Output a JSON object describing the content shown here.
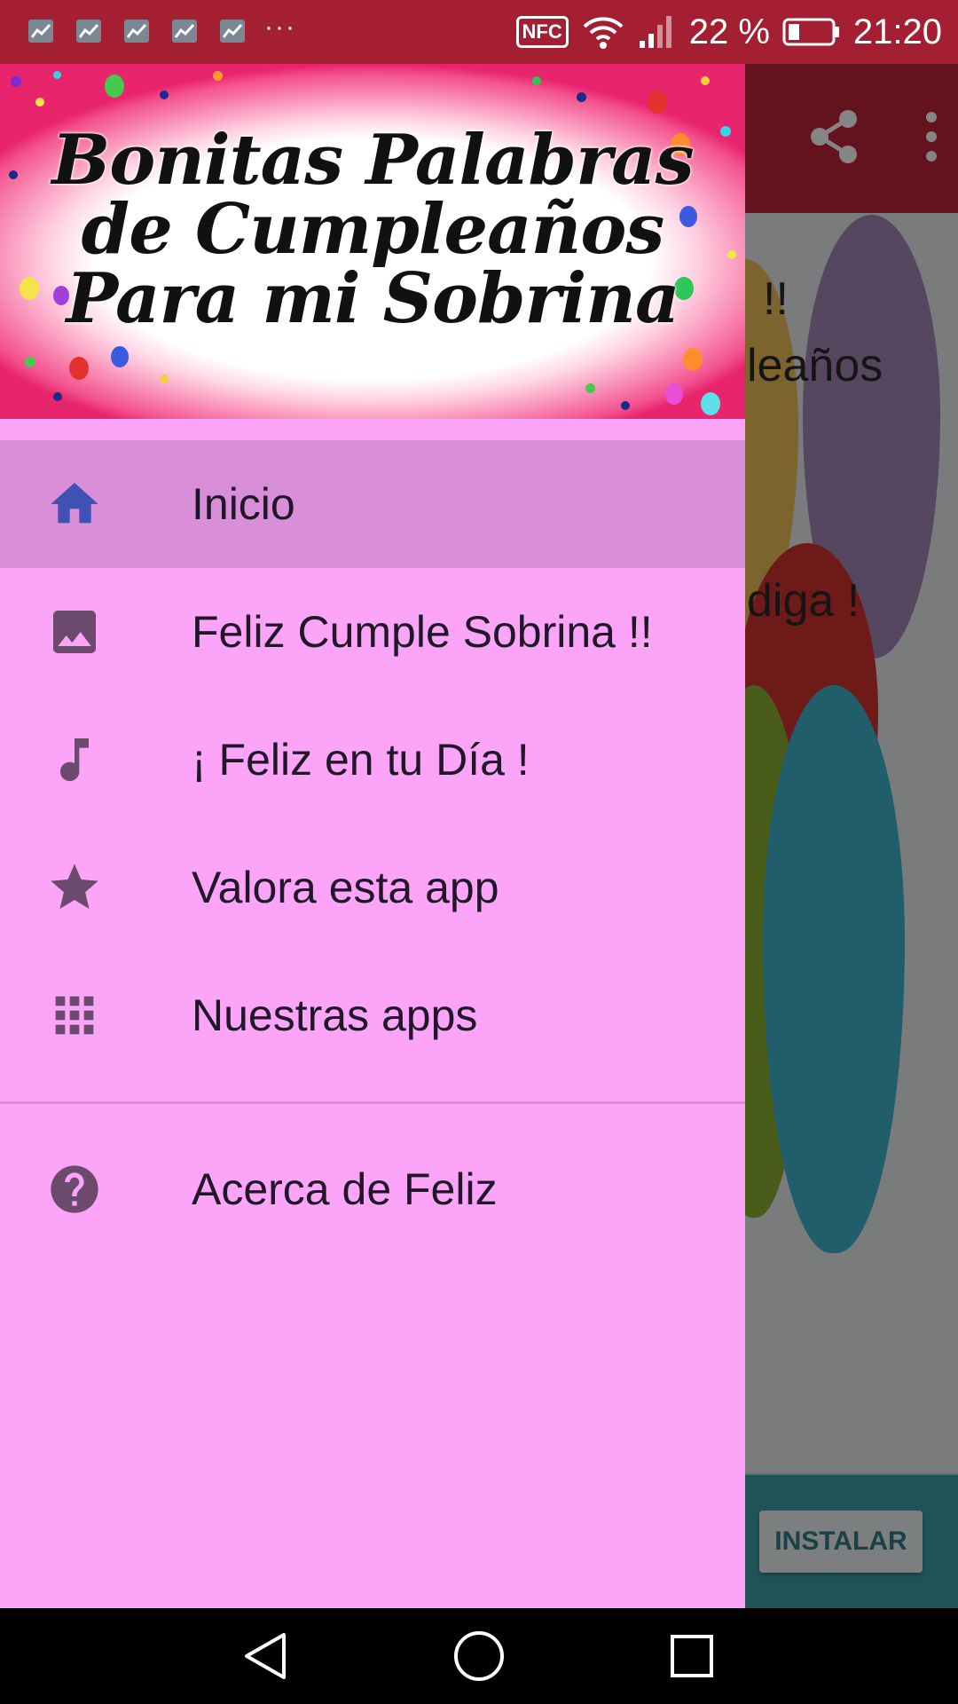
{
  "status_bar": {
    "notification_icons": [
      "chart-notification-icon",
      "chart-notification-icon",
      "chart-notification-icon",
      "chart-notification-icon",
      "chart-notification-icon"
    ],
    "more_label": "···",
    "nfc_label": "NFC",
    "battery_percent": "22 %",
    "time": "21:20",
    "color": "#a41f31"
  },
  "header": {
    "title_lines": [
      "Bonitas Palabras",
      "de Cumpleaños",
      "Para mi Sobrina"
    ]
  },
  "menu": {
    "items": [
      {
        "label": "Inicio",
        "icon": "home-icon",
        "active": true
      },
      {
        "label": "Feliz Cumple Sobrina !!",
        "icon": "image-icon",
        "active": false
      },
      {
        "label": "¡ Feliz en tu Día !",
        "icon": "music-note-icon",
        "active": false
      },
      {
        "label": "Valora esta app",
        "icon": "star-icon",
        "active": false
      },
      {
        "label": "Nuestras apps",
        "icon": "apps-grid-icon",
        "active": false
      },
      {
        "label": "Acerca de Feliz",
        "icon": "help-icon",
        "active": false
      }
    ]
  },
  "background": {
    "text_fragments": [
      "!!",
      "leaños",
      "diga !"
    ],
    "install_label": "INSTALAR"
  },
  "colors": {
    "drawer": "#fca4f8",
    "active_item": "#d98ed8",
    "icon_active": "#3f51b5",
    "icon_default": "#6b4a6e"
  }
}
